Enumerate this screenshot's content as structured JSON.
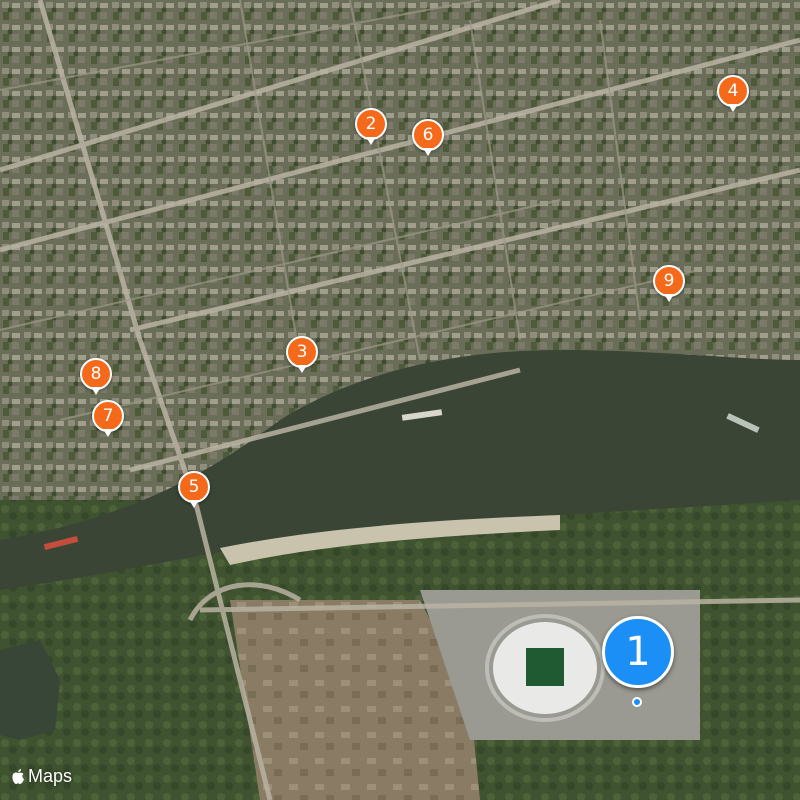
{
  "map": {
    "brand_label": "Maps",
    "brand_icon": "apple-logo-icon",
    "colors": {
      "river": "#3a4536",
      "pin_orange": "#f4691a",
      "pin_blue": "#1b8ff5"
    }
  },
  "pins": [
    {
      "label": "2",
      "icon": "map-pin-icon"
    },
    {
      "label": "6",
      "icon": "map-pin-icon"
    },
    {
      "label": "4",
      "icon": "map-pin-icon"
    },
    {
      "label": "9",
      "icon": "map-pin-icon"
    },
    {
      "label": "3",
      "icon": "map-pin-icon"
    },
    {
      "label": "8",
      "icon": "map-pin-icon"
    },
    {
      "label": "7",
      "icon": "map-pin-icon"
    },
    {
      "label": "5",
      "icon": "map-pin-icon"
    }
  ],
  "selected_pin": {
    "label": "1",
    "icon": "selected-location-pin-icon"
  }
}
